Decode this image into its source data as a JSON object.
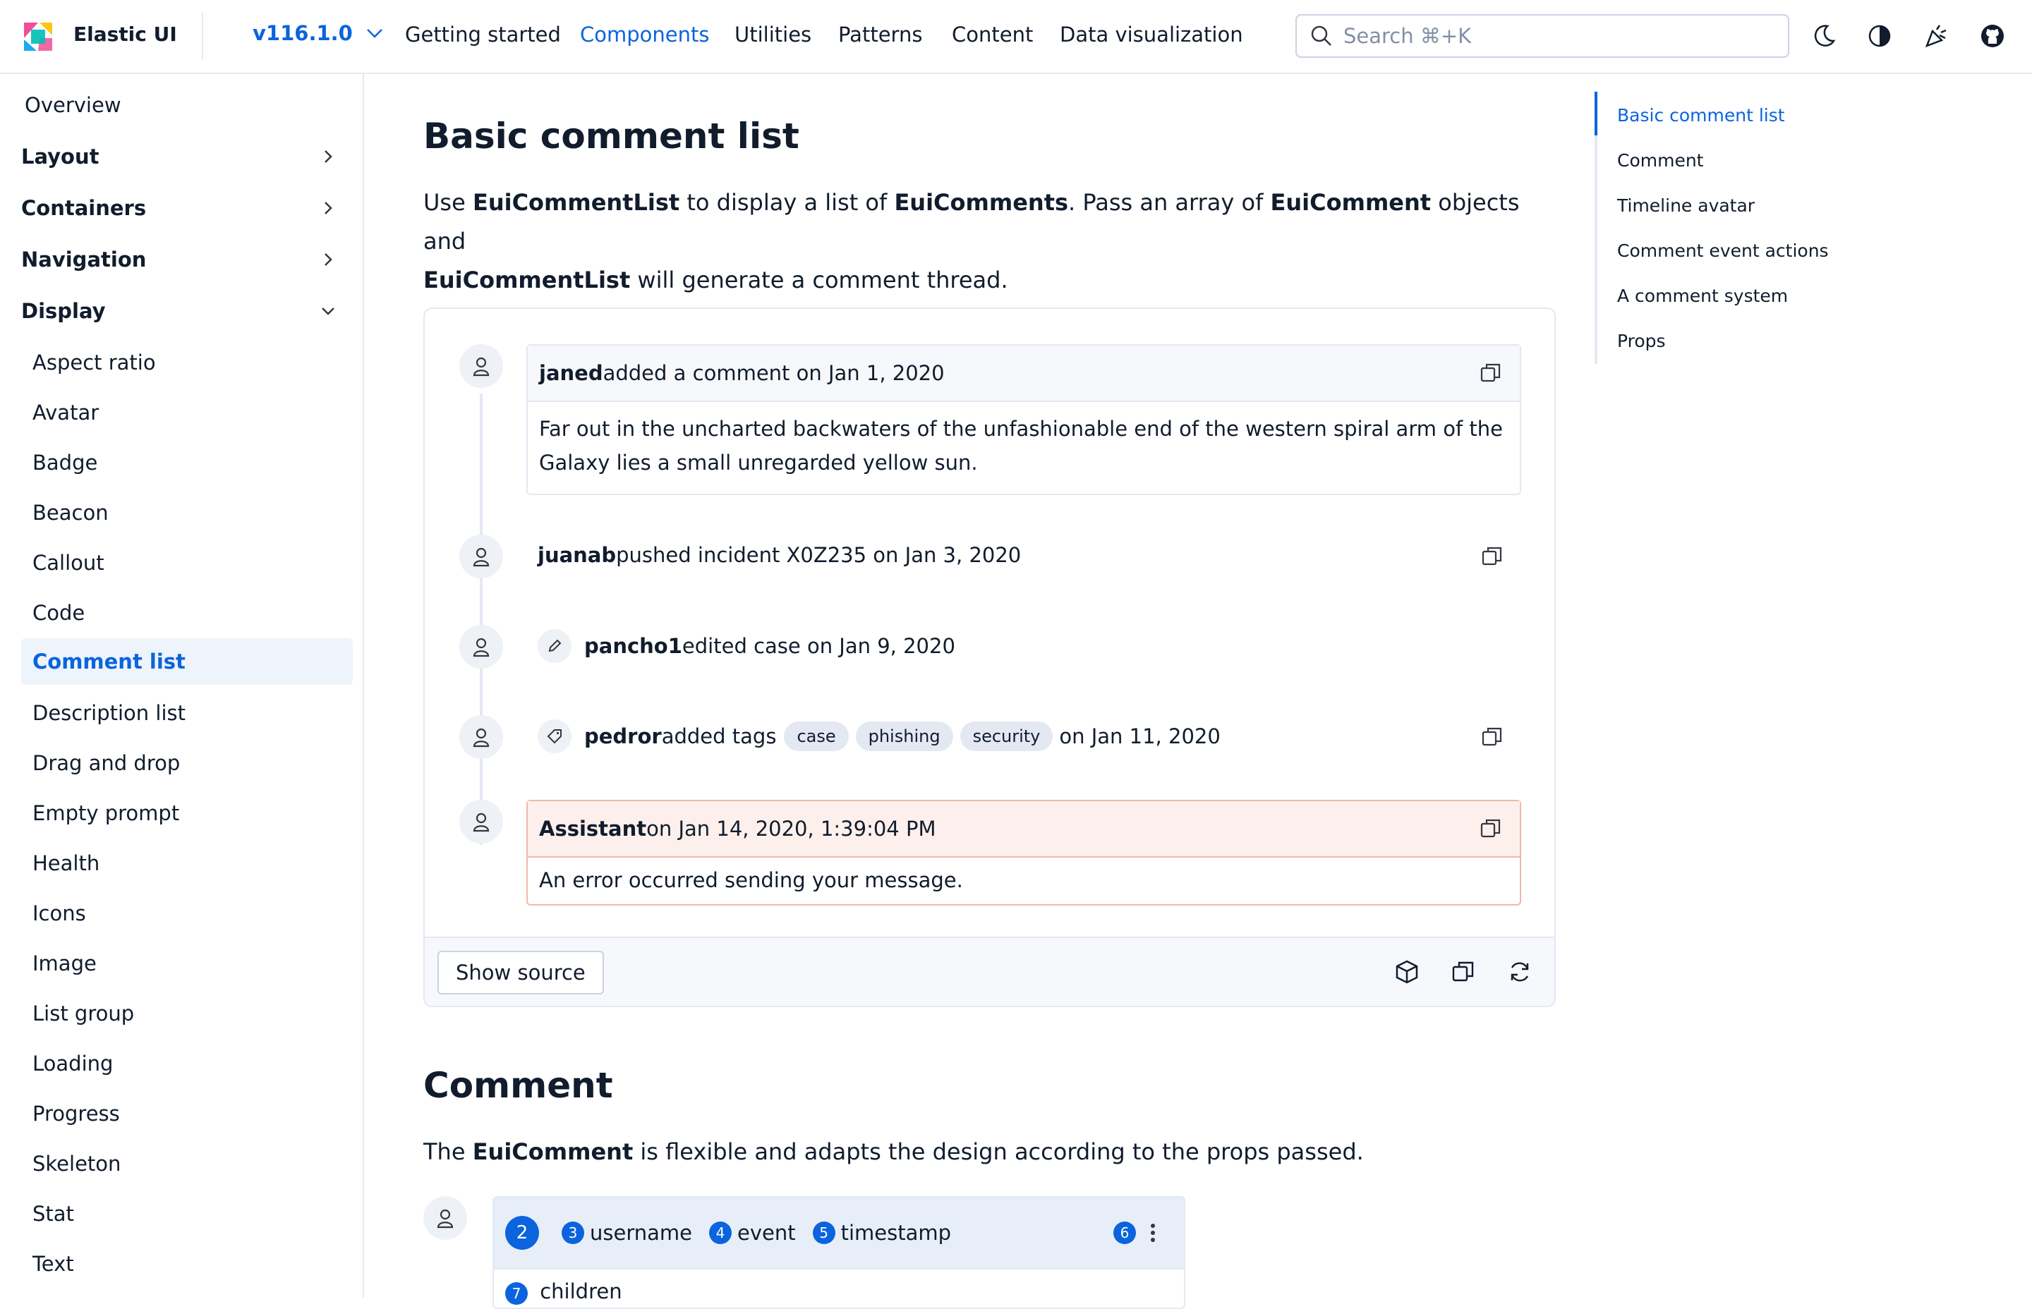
{
  "header": {
    "brand": "Elastic UI",
    "version": "v116.1.0",
    "nav": [
      "Getting started",
      "Components",
      "Utilities",
      "Patterns",
      "Content",
      "Data visualization"
    ],
    "active_nav": "Components",
    "search_placeholder": "Search ⌘+K",
    "icons": [
      "moon-icon",
      "contrast-icon",
      "party-icon",
      "github-icon"
    ]
  },
  "sidebar": {
    "overview": "Overview",
    "groups": [
      "Layout",
      "Containers",
      "Navigation",
      "Display"
    ],
    "display_items": [
      "Aspect ratio",
      "Avatar",
      "Badge",
      "Beacon",
      "Callout",
      "Code",
      "Comment list",
      "Description list",
      "Drag and drop",
      "Empty prompt",
      "Health",
      "Icons",
      "Image",
      "List group",
      "Loading",
      "Progress",
      "Skeleton",
      "Stat",
      "Text"
    ],
    "selected": "Comment list"
  },
  "main": {
    "title": "Basic comment list",
    "intro": {
      "p1": "Use ",
      "b1": "EuiCommentList",
      "p2": " to display a list of ",
      "b2": "EuiComments",
      "p3": ". Pass an array of ",
      "b3": "EuiComment",
      "p4": " objects and",
      "b4": "EuiCommentList",
      "p5": " will generate a comment thread."
    },
    "comments": {
      "c1": {
        "user": "janed",
        "event": " added a comment on Jan 1, 2020",
        "body": "Far out in the uncharted backwaters of the unfashionable end of the western spiral arm of the Galaxy lies a small unregarded yellow sun."
      },
      "c2": {
        "user": "juanab",
        "event": " pushed incident X0Z235 on Jan 3, 2020"
      },
      "c3": {
        "user": "pancho1",
        "event": " edited case on Jan 9, 2020"
      },
      "c4": {
        "user": "pedror",
        "event": " added tags",
        "tags": [
          "case",
          "phishing",
          "security"
        ],
        "event_end": "on Jan 11, 2020"
      },
      "c5": {
        "user": "Assistant",
        "event": " on Jan 14, 2020, 1:39:04 PM",
        "body": "An error occurred sending your message."
      }
    },
    "show_source": "Show source",
    "section2_title": "Comment",
    "section2_text": {
      "p1": "The ",
      "b1": "EuiComment",
      "p2": " is flexible and adapts the design according to the props passed."
    },
    "anatomy": {
      "n2": "2",
      "n3": "3",
      "n4": "4",
      "n5": "5",
      "n6": "6",
      "n7": "7",
      "username": "username",
      "event": "event",
      "timestamp": "timestamp",
      "children": "children"
    }
  },
  "toc": {
    "items": [
      "Basic comment list",
      "Comment",
      "Timeline avatar",
      "Comment event actions",
      "A comment system",
      "Props"
    ],
    "active": "Basic comment list"
  },
  "colors": {
    "accent": "#0b64dd",
    "error_border": "#f0b9a7",
    "error_bg": "#fdf0ec",
    "panel": "#f6f8fc"
  }
}
